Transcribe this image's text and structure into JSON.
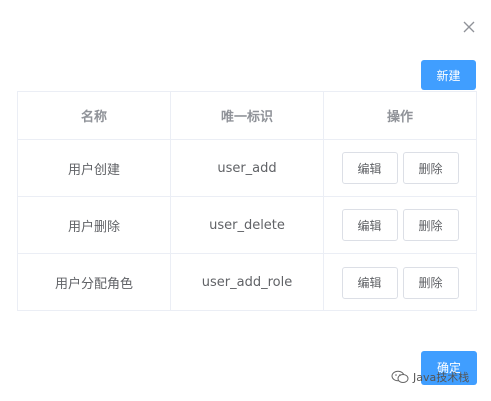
{
  "dialog": {
    "close_icon": "close-icon",
    "new_button": "新建",
    "confirm_button": "确定"
  },
  "table": {
    "columns": [
      "名称",
      "唯一标识",
      "操作"
    ],
    "rows": [
      {
        "name": "用户创建",
        "key": "user_add",
        "edit": "编辑",
        "delete": "删除"
      },
      {
        "name": "用户删除",
        "key": "user_delete",
        "edit": "编辑",
        "delete": "删除"
      },
      {
        "name": "用户分配角色",
        "key": "user_add_role",
        "edit": "编辑",
        "delete": "删除"
      }
    ]
  },
  "watermark": {
    "icon": "wechat-icon",
    "text": "Java技术栈"
  },
  "colors": {
    "primary": "#409eff",
    "border": "#ebeef5",
    "header_text": "#909399",
    "body_text": "#606266"
  }
}
